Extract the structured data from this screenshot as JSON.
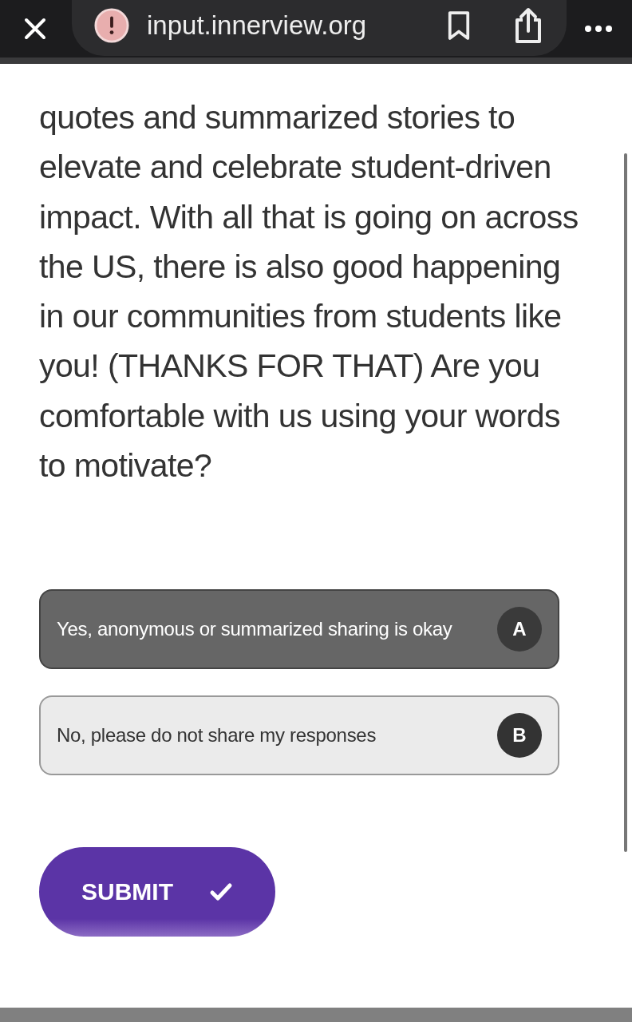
{
  "browser_bar": {
    "url": "input.innerview.org"
  },
  "question": "quotes and summarized stories to elevate and celebrate student-driven impact. With all that is going on across the US, there is also good happening in our communities from students like you! (THANKS FOR THAT) Are you comfortable with us using your words to motivate?",
  "options": [
    {
      "label": "Yes, anonymous or summarized sharing is okay",
      "key": "A",
      "selected": true
    },
    {
      "label": "No, please do not share my responses",
      "key": "B",
      "selected": false
    }
  ],
  "submit": {
    "label": "SUBMIT"
  }
}
